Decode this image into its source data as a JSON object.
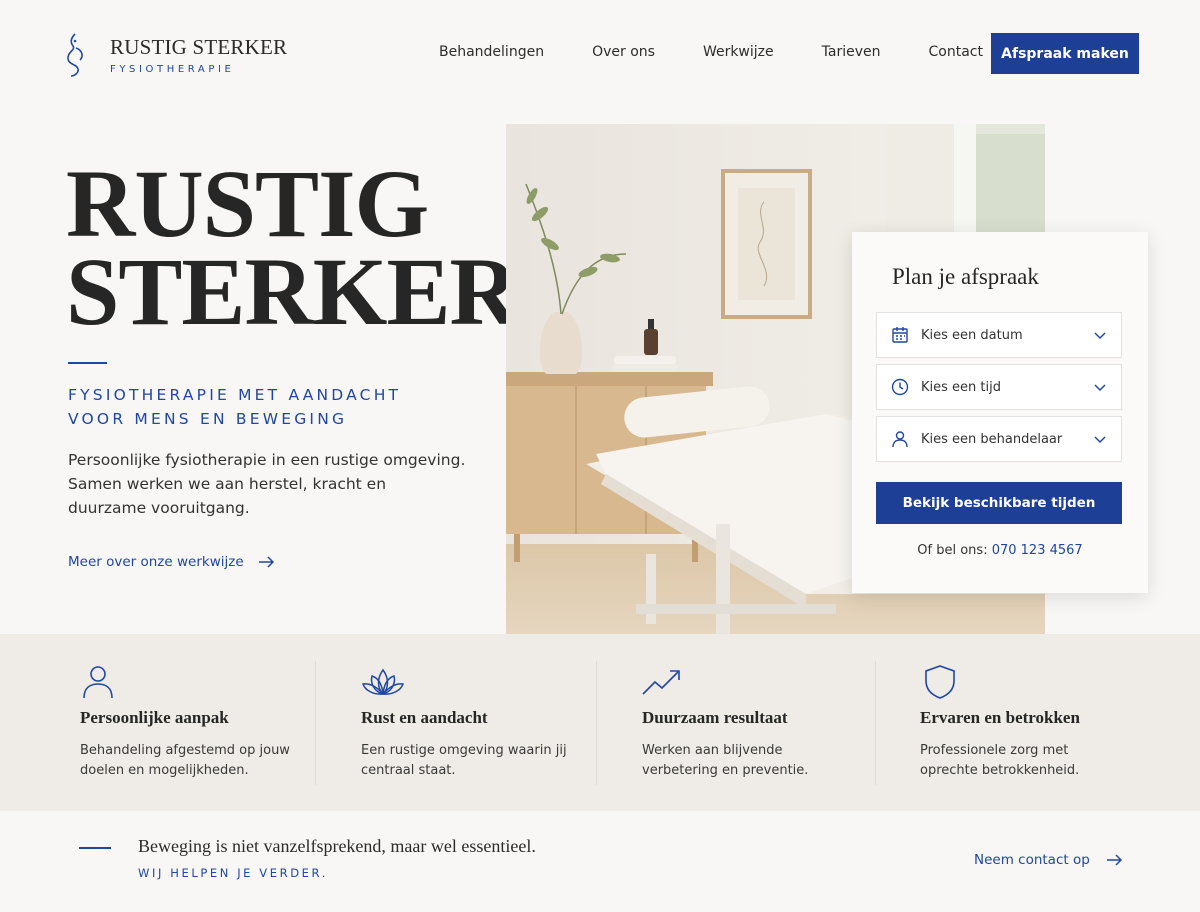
{
  "brand": {
    "name": "RUSTIG STERKER",
    "subtitle": "FYSIOTHERAPIE",
    "accent_color": "#1f47a3",
    "button_color": "#1d3f96"
  },
  "nav": {
    "items": [
      {
        "label": "Behandelingen"
      },
      {
        "label": "Over ons"
      },
      {
        "label": "Werkwijze"
      },
      {
        "label": "Tarieven"
      },
      {
        "label": "Contact"
      }
    ],
    "cta_label": "Afspraak maken"
  },
  "hero": {
    "title_line1": "RUSTIG",
    "title_line2": "STERKER",
    "subtitle_line1": "FYSIOTHERAPIE MET AANDACHT",
    "subtitle_line2": "VOOR MENS EN BEWEGING",
    "body": "Persoonlijke fysiotherapie in een rustige omgeving. Samen werken we aan herstel, kracht en duurzame vooruitgang.",
    "link_label": "Meer over onze werkwijze"
  },
  "booking": {
    "title": "Plan je afspraak",
    "date_placeholder": "Kies een datum",
    "time_placeholder": "Kies een tijd",
    "therapist_placeholder": "Kies een behandelaar",
    "button_label": "Bekijk beschikbare tijden",
    "phone_prefix": "Of bel ons:",
    "phone_number": "070 123 4567"
  },
  "features": [
    {
      "icon": "person-icon",
      "title": "Persoonlijke aanpak",
      "text": "Behandeling afgestemd op jouw doelen en mogelijkheden."
    },
    {
      "icon": "lotus-icon",
      "title": "Rust en aandacht",
      "text": "Een rustige omgeving waarin jij centraal staat."
    },
    {
      "icon": "trend-up-icon",
      "title": "Duurzaam resultaat",
      "text": "Werken aan blijvende verbetering en preventie."
    },
    {
      "icon": "shield-icon",
      "title": "Ervaren en betrokken",
      "text": "Professionele zorg met oprechte betrokkenheid."
    }
  ],
  "closing": {
    "quote": "Beweging is niet vanzelfsprekend, maar wel essentieel.",
    "sub": "WIJ HELPEN JE VERDER.",
    "contact_label": "Neem contact op"
  }
}
